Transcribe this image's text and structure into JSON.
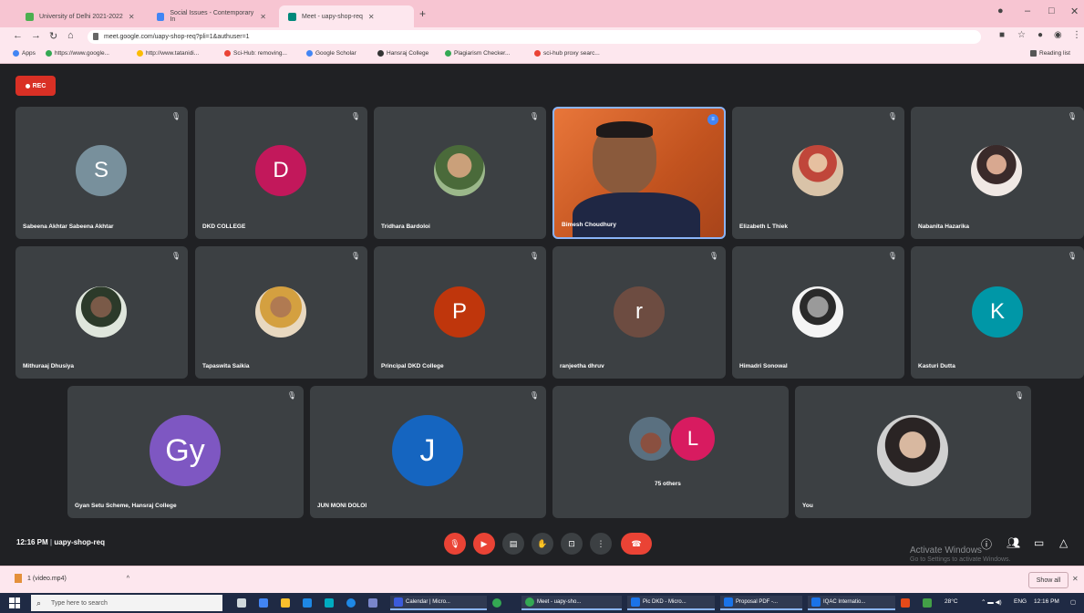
{
  "browser": {
    "tabs": [
      {
        "label": "University of Delhi 2021-2022",
        "color": "#4caf50"
      },
      {
        "label": "Social Issues - Contemporary In",
        "color": "#4285f4"
      },
      {
        "label": "Meet - uapy-shop-req",
        "color": "#00897b"
      }
    ],
    "url": "meet.google.com/uapy-shop-req?pli=1&authuser=1",
    "bookmarks": [
      {
        "label": "Apps",
        "color": "#4285f4"
      },
      {
        "label": "https://www.google...",
        "color": "#34a853"
      },
      {
        "label": "http://www.tatanidi...",
        "color": "#fbbc04"
      },
      {
        "label": "Sci-Hub: removing...",
        "color": "#ea4335"
      },
      {
        "label": "Google Scholar",
        "color": "#4285f4"
      },
      {
        "label": "Hansraj College",
        "color": "#333333"
      },
      {
        "label": "Plagiarism Checker...",
        "color": "#34a853"
      },
      {
        "label": "sci-hub proxy searc...",
        "color": "#ea4335"
      }
    ],
    "reading_list": "Reading list"
  },
  "meet": {
    "rec_label": "REC",
    "time": "12:16 PM",
    "meeting_code": "uapy-shop-req",
    "participants": [
      {
        "name": "Sabeena Akhtar Sabeena Akhtar",
        "initial": "S",
        "color": "#78909c"
      },
      {
        "name": "DKD COLLEGE",
        "initial": "D",
        "color": "#c2185b"
      },
      {
        "name": "Tridhara Bardoloi",
        "initial": "",
        "color": "#7a9a6a"
      },
      {
        "name": "Bimesh Choudhury",
        "initial": "",
        "color": "#e07a3a"
      },
      {
        "name": "Elizabeth L Thiek",
        "initial": "",
        "color": "#b08060"
      },
      {
        "name": "Nabanita Hazarika",
        "initial": "",
        "color": "#caa79b"
      },
      {
        "name": "Mithuraaj Dhusiya",
        "initial": "",
        "color": "#556b5a"
      },
      {
        "name": "Tapaswita Saikia",
        "initial": "",
        "color": "#a0704a"
      },
      {
        "name": "Principal DKD College",
        "initial": "P",
        "color": "#bf360c"
      },
      {
        "name": "ranjeetha dhruv",
        "initial": "r",
        "color": "#6d4c41"
      },
      {
        "name": "Himadri Sonowal",
        "initial": "",
        "color": "#cfcfcf"
      },
      {
        "name": "Kasturi Dutta",
        "initial": "K",
        "color": "#0097a7"
      },
      {
        "name": "Gyan Setu Scheme, Hansraj College",
        "initial": "Gy",
        "color": "#7e57c2"
      },
      {
        "name": "JUN MONI DOLOI",
        "initial": "J",
        "color": "#1565c0"
      },
      {
        "name": "75 others",
        "initial": "L",
        "color": "#d81b60"
      },
      {
        "name": "You",
        "initial": "",
        "color": "#9e9e9e"
      }
    ],
    "watermark_title": "Activate Windows",
    "watermark_sub": "Go to Settings to activate Windows."
  },
  "downloads": {
    "file": "1 (video.mp4)",
    "show_all": "Show all"
  },
  "taskbar": {
    "search_placeholder": "Type here to search",
    "apps": [
      {
        "label": "Calendar | Micro...",
        "color": "#3b5bdb"
      },
      {
        "label": "Meet - uapy-sho...",
        "color": "#34a853"
      },
      {
        "label": "Pic DKD - Micro...",
        "color": "#1a73e8"
      },
      {
        "label": "Proposal PDF -...",
        "color": "#1a73e8"
      },
      {
        "label": "IQAC Internatio...",
        "color": "#1a73e8"
      }
    ],
    "weather": "28°C",
    "clock": "12:16 PM",
    "lang": "ENG"
  }
}
